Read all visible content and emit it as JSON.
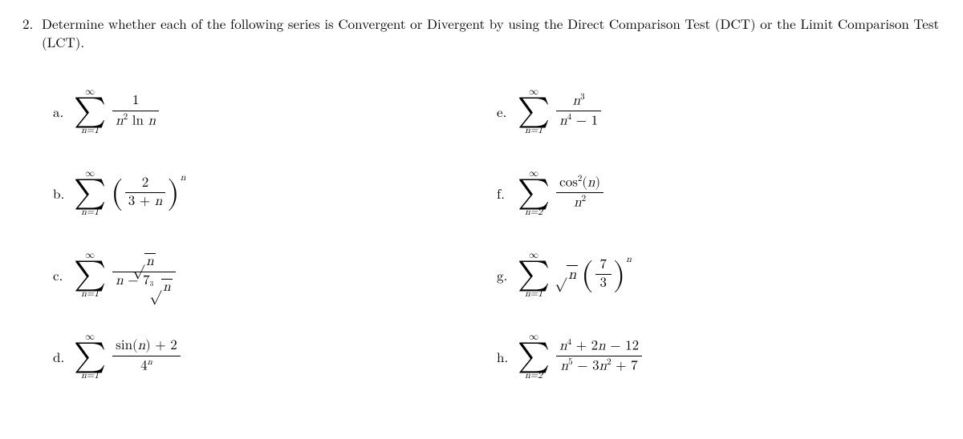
{
  "problem": {
    "number": "2.",
    "prompt": "Determine whether each of the following series is Convergent or Divergent by using the Direct Comparison Test (DCT) or the Limit Comparison Test (LCT)."
  },
  "items": {
    "a": {
      "label": "a.",
      "top": "∞",
      "bot": "n=1",
      "num": "1",
      "den_n2": "n",
      "den_exp": "2",
      "den_ln": " ln ",
      "den_n": "n"
    },
    "b": {
      "label": "b.",
      "top": "∞",
      "bot": "n=1",
      "num": "2",
      "den": "3 + n",
      "exp": "n"
    },
    "c": {
      "label": "c.",
      "top": "∞",
      "bot": "n=1",
      "num_sqrt": "n",
      "den_pre": "n − 7",
      "den_idx": "3",
      "den_sqrt": "n"
    },
    "d": {
      "label": "d.",
      "top": "∞",
      "bot": "n=1",
      "num": "sin(n) + 2",
      "den_base": "4",
      "den_exp": "n"
    },
    "e": {
      "label": "e.",
      "top": "∞",
      "bot": "n=1",
      "num_n": "n",
      "num_exp": "3",
      "den_n": "n",
      "den_exp": "4",
      "den_rest": " − 1"
    },
    "f": {
      "label": "f.",
      "top": "∞",
      "bot": "n=2",
      "num_cos": "cos",
      "num_exp": "2",
      "num_arg": "(n)",
      "den_n": "n",
      "den_exp": "2"
    },
    "g": {
      "label": "g.",
      "top": "∞",
      "bot": "n=1",
      "sqrt": "n",
      "frac_num": "7",
      "frac_den": "3",
      "exp": "n"
    },
    "h": {
      "label": "h.",
      "top": "∞",
      "bot": "n=2",
      "num": "n⁴ + 2n − 12",
      "den": "n⁵ − 3n² + 7"
    }
  }
}
